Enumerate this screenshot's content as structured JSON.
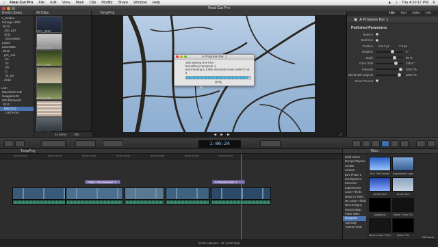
{
  "menubar": {
    "apple_icon": "apple-icon",
    "app_name": "Final Cut Pro",
    "items": [
      "File",
      "Edit",
      "View",
      "Mark",
      "Clip",
      "Modify",
      "Share",
      "Window",
      "Help"
    ],
    "clock": "Thu 4:20:17 PM"
  },
  "window": {
    "title": "Final Cut Pro"
  },
  "library": {
    "header": "Event Library",
    "items": [
      "A_ëvideo",
      "tomega HOD",
      "2012",
      "Jan_y12",
      "2011",
      "December",
      "LaCie",
      "LaCie256",
      "2012",
      "pre_ock",
      "bc",
      "bc",
      "bb",
      "b",
      "St_ue",
      "2012",
      "",
      "Lion",
      "Macintosh HD",
      "Seagate128",
      "WD Elements",
      "2012",
      "March12",
      "Lost Hour"
    ]
  },
  "browser": {
    "header": "All Clips",
    "clips": [
      "HDV_0962",
      "HDV_0861",
      "HDV_0965",
      "",
      "HDV_0965",
      "",
      "HDV_1081"
    ],
    "count": "14 items",
    "zoom": "30s"
  },
  "viewer": {
    "header": "TempProj",
    "timecode": "1:06:24"
  },
  "dialog": {
    "title": "A Progress Bar :)",
    "line1": "Just wasting time here -",
    "line2": "but calling it 'progress ;)",
    "line3": "and throwing in a little automatic reuse while I'm at it",
    "progress": 0.97,
    "percent_text": "97%"
  },
  "inspector": {
    "tabs": [
      "Title",
      "Text",
      "Video",
      "Info"
    ],
    "title_label": "A Progress Bar :)",
    "section": "Published Parameters",
    "params": [
      {
        "label": "Build In",
        "kind": "check"
      },
      {
        "label": "Build Out",
        "kind": "check"
      },
      {
        "label": "Position",
        "kind": "value",
        "v1": "X  0.7 px",
        "v2": "Y  0 px"
      },
      {
        "label": "Rotation",
        "kind": "slider",
        "value": "0 °",
        "level": 0.6
      },
      {
        "label": "Scale",
        "kind": "slider",
        "value": "96 %",
        "level": 0.7
      },
      {
        "label": "Color Shift",
        "kind": "slider",
        "value": "226.5 °",
        "level": 0.75
      },
      {
        "label": "Intensity",
        "kind": "slider",
        "value": "100.0 %",
        "level": 0.95
      },
      {
        "label": "Blend with Original",
        "kind": "slider",
        "value": "100.0 %",
        "level": 0.9
      },
      {
        "label": "Show Percent",
        "kind": "check"
      }
    ]
  },
  "timeline": {
    "project": "TempProj",
    "ruler": [
      "00:00:00:00",
      "00:00:05:00",
      "00:00:10:00",
      "00:00:15:00",
      "00:00:20:00",
      "00:00:25:00",
      "00:00:30:00"
    ],
    "title_clips": [
      "A Bar - ProgressBar :)",
      "A Progress Bar :)"
    ],
    "status": "10:00 selected - 01:13:00 total"
  },
  "titles_browser": {
    "header": "Titles",
    "categories": [
      "Build In/Out",
      "Bumper/Opener",
      "Credits",
      "Custom",
      "Dev Phase 2",
      "development",
      "Elements",
      "Experiments",
      "Lower Thirds",
      "Motion 5 Titles",
      "My Lower Thirds",
      "New Designs",
      "NewDesktop",
      "Pulse Titles",
      "Requests",
      "Specialty",
      "Tutorial Tools"
    ],
    "thumbs": [
      "50's Title Screen",
      "Adjustment Layer",
      "Arrival Text",
      "Arrow Text",
      "Aspiration",
      "Barrel Turns HD",
      "Basic Lower Third",
      "Basic Title"
    ],
    "count": "340 items"
  },
  "colors": {
    "accent": "#4a74b0",
    "progress": "#2f9fd1",
    "playhead": "#d84c3a",
    "title_clip": "#8a7bb5"
  }
}
